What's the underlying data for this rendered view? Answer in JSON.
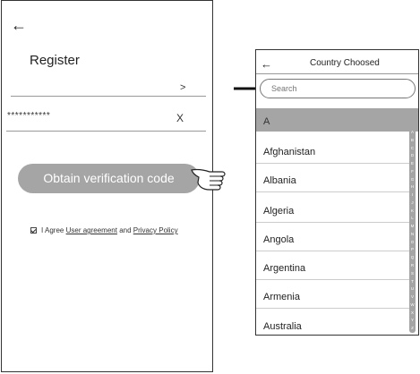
{
  "register_screen": {
    "back_glyph": "←",
    "title": "Register",
    "account_arrow": ">",
    "password_mask": "***********",
    "clear_label": "X",
    "obtain_button": "Obtain verification code",
    "agree_prefix": "I Agree",
    "user_agreement": "User agreement",
    "and_text": "and",
    "privacy_policy": "Privacy Policy"
  },
  "country_screen": {
    "back_glyph": "←",
    "title": "Country Choosed",
    "search_placeholder": "Search",
    "section_header": "A",
    "countries": [
      "Afghanistan",
      "Albania",
      "Algeria",
      "Angola",
      "Argentina",
      "Armenia",
      "Australia"
    ],
    "alphabet": [
      "A",
      "B",
      "C",
      "D",
      "E",
      "F",
      "G",
      "H",
      "I",
      "J",
      "K",
      "L",
      "M",
      "N",
      "O",
      "P",
      "Q",
      "R",
      "S",
      "T",
      "U",
      "V",
      "W",
      "X",
      "Y",
      "Z"
    ]
  },
  "colors": {
    "button_gray": "#a5a5a5",
    "text_dark": "#222222"
  },
  "icons": {
    "pointer": "hand-pointer-icon",
    "arrow": "right-arrow-icon"
  }
}
